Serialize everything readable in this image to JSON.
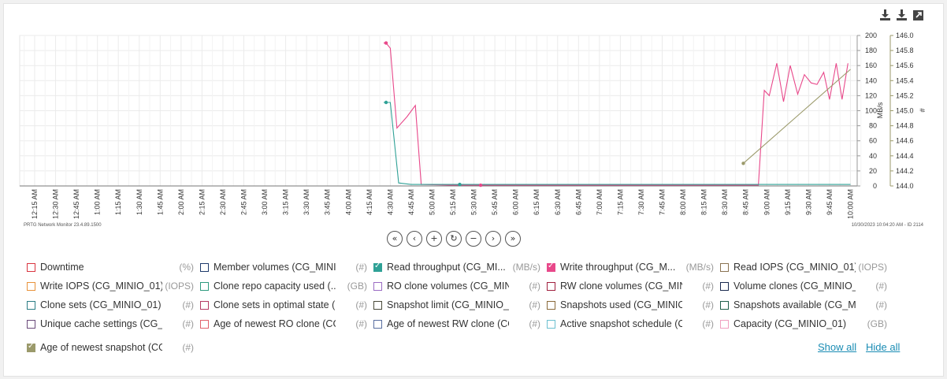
{
  "toolbar": {
    "icons": [
      "download-icon",
      "download-all-icon",
      "expand-icon"
    ]
  },
  "chart_data": {
    "type": "line",
    "x_ticks": [
      "12:15 AM",
      "12:30 AM",
      "12:45 AM",
      "1:00 AM",
      "1:15 AM",
      "1:30 AM",
      "1:45 AM",
      "2:00 AM",
      "2:15 AM",
      "2:30 AM",
      "2:45 AM",
      "3:00 AM",
      "3:15 AM",
      "3:30 AM",
      "3:45 AM",
      "4:00 AM",
      "4:15 AM",
      "4:30 AM",
      "4:45 AM",
      "5:00 AM",
      "5:15 AM",
      "5:30 AM",
      "5:45 AM",
      "6:00 AM",
      "6:15 AM",
      "6:30 AM",
      "6:45 AM",
      "7:00 AM",
      "7:15 AM",
      "7:30 AM",
      "7:45 AM",
      "8:00 AM",
      "8:15 AM",
      "8:30 AM",
      "8:45 AM",
      "9:00 AM",
      "9:15 AM",
      "9:30 AM",
      "9:45 AM",
      "10:00 AM"
    ],
    "y_left": {
      "label": "MB/s",
      "ticks": [
        0,
        20,
        40,
        60,
        80,
        100,
        120,
        140,
        160,
        180,
        200
      ],
      "range": [
        0,
        200
      ]
    },
    "y_right": {
      "label": "#",
      "ticks": [
        "144.0",
        "144.2",
        "144.4",
        "144.6",
        "144.8",
        "145.0",
        "145.2",
        "145.4",
        "145.6",
        "145.8",
        "146.0"
      ],
      "range": [
        144.0,
        146.0
      ]
    },
    "series": [
      {
        "name": "Write throughput (CG_MINIO_01)",
        "color": "#e8488a",
        "axis": "left",
        "points": [
          [
            4.42,
            190
          ],
          [
            4.45,
            190
          ],
          [
            4.5,
            183
          ],
          [
            4.58,
            77
          ],
          [
            4.7,
            92
          ],
          [
            4.8,
            107
          ],
          [
            4.87,
            2
          ],
          [
            5.2,
            1
          ],
          [
            5.5,
            1
          ],
          [
            6.0,
            1
          ],
          [
            7.0,
            1
          ],
          [
            8.0,
            1
          ],
          [
            8.5,
            1
          ],
          [
            8.9,
            1
          ],
          [
            8.97,
            127
          ],
          [
            9.03,
            120
          ],
          [
            9.12,
            163
          ],
          [
            9.2,
            112
          ],
          [
            9.28,
            160
          ],
          [
            9.37,
            122
          ],
          [
            9.45,
            148
          ],
          [
            9.53,
            137
          ],
          [
            9.6,
            135
          ],
          [
            9.68,
            151
          ],
          [
            9.75,
            115
          ],
          [
            9.83,
            163
          ],
          [
            9.9,
            115
          ],
          [
            9.97,
            163
          ]
        ]
      },
      {
        "name": "Read throughput (CG_MINIO_01)",
        "color": "#2fa196",
        "axis": "left",
        "points": [
          [
            4.42,
            111
          ],
          [
            4.45,
            111
          ],
          [
            4.5,
            111
          ],
          [
            4.6,
            4
          ],
          [
            4.75,
            2
          ],
          [
            5.0,
            2
          ],
          [
            5.25,
            2
          ],
          [
            6.0,
            2
          ],
          [
            7.0,
            2
          ],
          [
            8.0,
            2
          ],
          [
            9.0,
            2
          ],
          [
            10.0,
            2
          ]
        ]
      },
      {
        "name": "Age of newest snapshot (CG_MINIO_01)",
        "color": "#9b9a6b",
        "axis": "right",
        "points": [
          [
            8.72,
            144.3
          ],
          [
            10.0,
            145.55
          ]
        ]
      }
    ],
    "markers": [
      {
        "series": 0,
        "x": 4.45,
        "y": 190
      },
      {
        "series": 1,
        "x": 4.45,
        "y": 111
      },
      {
        "series": 1,
        "x": 5.33,
        "y": 2
      },
      {
        "series": 0,
        "x": 5.58,
        "y": 1
      },
      {
        "series": 2,
        "x": 8.72,
        "y": 144.3
      }
    ],
    "footer_left": "PRTG Network Monitor 23.4.89.1500",
    "footer_right": "10/30/2023 10:04:20 AM - ID 2114"
  },
  "nav": {
    "buttons": [
      {
        "symbol": "«",
        "name": "rewind-far-button"
      },
      {
        "symbol": "‹",
        "name": "back-button"
      },
      {
        "symbol": "+",
        "name": "zoom-in-button"
      },
      {
        "symbol": "↻",
        "name": "reset-button"
      },
      {
        "symbol": "−",
        "name": "zoom-out-button"
      },
      {
        "symbol": "›",
        "name": "forward-button"
      },
      {
        "symbol": "»",
        "name": "forward-far-button"
      }
    ]
  },
  "legend": {
    "items": [
      {
        "label": "Downtime",
        "unit": "(%)",
        "color": "#d9343f",
        "checked": false
      },
      {
        "label": "Member volumes (CG_MINI...",
        "unit": "(#)",
        "color": "#1e3a6b",
        "checked": false
      },
      {
        "label": "Read throughput (CG_MI...",
        "unit": "(MB/s)",
        "color": "#2fa196",
        "checked": true
      },
      {
        "label": "Write throughput (CG_M...",
        "unit": "(MB/s)",
        "color": "#e8488a",
        "checked": true
      },
      {
        "label": "Read IOPS (CG_MINIO_01)",
        "unit": "(IOPS)",
        "color": "#8a7352",
        "checked": false
      },
      {
        "label": "Write IOPS (CG_MINIO_01)",
        "unit": "(IOPS)",
        "color": "#e8923a",
        "checked": false
      },
      {
        "label": "Clone repo capacity used (...",
        "unit": "(GB)",
        "color": "#2e9a7e",
        "checked": false
      },
      {
        "label": "RO clone volumes (CG_MINI...",
        "unit": "(#)",
        "color": "#9b6cc4",
        "checked": false
      },
      {
        "label": "RW clone volumes (CG_MINI...",
        "unit": "(#)",
        "color": "#a01f3e",
        "checked": false
      },
      {
        "label": "Volume clones (CG_MINIO_0...",
        "unit": "(#)",
        "color": "#1a2a4f",
        "checked": false
      },
      {
        "label": "Clone sets (CG_MINIO_01)",
        "unit": "(#)",
        "color": "#2b7d85",
        "checked": false
      },
      {
        "label": "Clone sets in optimal state (...",
        "unit": "(#)",
        "color": "#b53b64",
        "checked": false
      },
      {
        "label": "Snapshot limit (CG_MINIO_01)",
        "unit": "(#)",
        "color": "#4a4a3a",
        "checked": false
      },
      {
        "label": "Snapshots used (CG_MINIO_...",
        "unit": "(#)",
        "color": "#8a6a3a",
        "checked": false
      },
      {
        "label": "Snapshots available (CG_MI...",
        "unit": "(#)",
        "color": "#1f5f4a",
        "checked": false
      },
      {
        "label": "Unique cache settings (CG_...",
        "unit": "(#)",
        "color": "#6a4a7a",
        "checked": false
      },
      {
        "label": "Age of newest RO clone (CG...",
        "unit": "(#)",
        "color": "#e0606a",
        "checked": false
      },
      {
        "label": "Age of newest RW clone (CG...",
        "unit": "(#)",
        "color": "#5a6fa0",
        "checked": false
      },
      {
        "label": "Active snapshot schedule (C...",
        "unit": "(#)",
        "color": "#6cc0d0",
        "checked": false
      },
      {
        "label": "Capacity (CG_MINIO_01)",
        "unit": "(GB)",
        "color": "#f0a0c0",
        "checked": false
      },
      {
        "label": "Age of newest snapshot (CG...",
        "unit": "(#)",
        "color": "#9b9a6b",
        "checked": true
      }
    ],
    "show_all": "Show all",
    "hide_all": "Hide all"
  }
}
